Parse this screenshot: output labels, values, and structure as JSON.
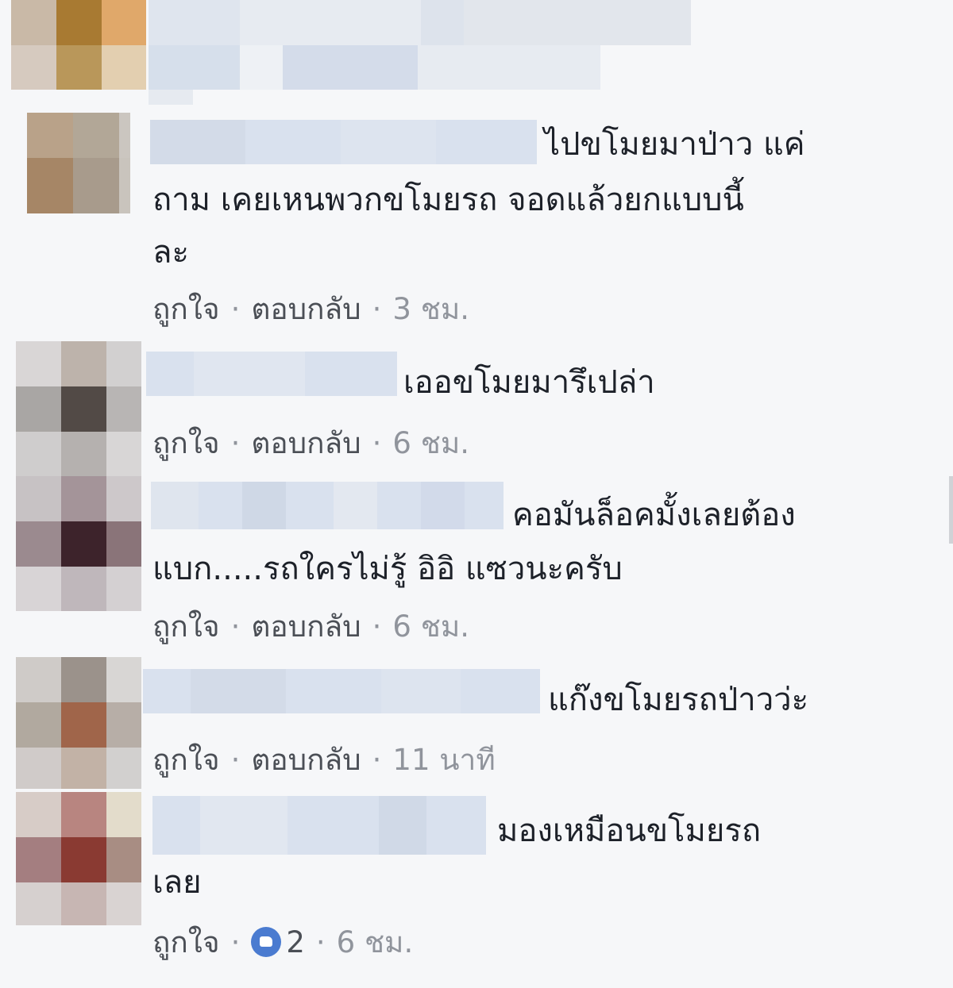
{
  "comments": [
    {
      "lines": [
        "ไปขโมยมาป่าว แค่",
        "ถาม เคยเหนพวกขโมยรถ จอดแล้วยกแบบนี้",
        "ละ"
      ],
      "like_label": "ถูกใจ",
      "reply_label": "ตอบกลับ",
      "time": "3 ชม."
    },
    {
      "lines": [
        "เออขโมยมารึเปล่า"
      ],
      "like_label": "ถูกใจ",
      "reply_label": "ตอบกลับ",
      "time": "6 ชม."
    },
    {
      "lines": [
        "คอมันล็อคมั้งเลยต้อง",
        "แบก.....รถใครไม่รู้ อิอิ แซวนะครับ"
      ],
      "like_label": "ถูกใจ",
      "reply_label": "ตอบกลับ",
      "time": "6 ชม."
    },
    {
      "lines": [
        "แก๊งขโมยรถป่าวว่ะ"
      ],
      "like_label": "ถูกใจ",
      "reply_label": "ตอบกลับ",
      "time": "11 นาที"
    },
    {
      "lines": [
        "มองเหมือนขโมยรถ",
        "เลย"
      ],
      "like_label": "ถูกใจ",
      "reply_label": "ตอบกลับ",
      "reactions": "2",
      "time": "6 ชม."
    }
  ],
  "colors": {
    "background": "#f6f7f9",
    "text": "#1d2129",
    "action_link": "#4b4f56",
    "meta": "#90949c",
    "like_reaction": "#4a7bd0",
    "blurred_name": "#d9e1ee"
  },
  "icons": [
    "like-reaction-icon"
  ]
}
